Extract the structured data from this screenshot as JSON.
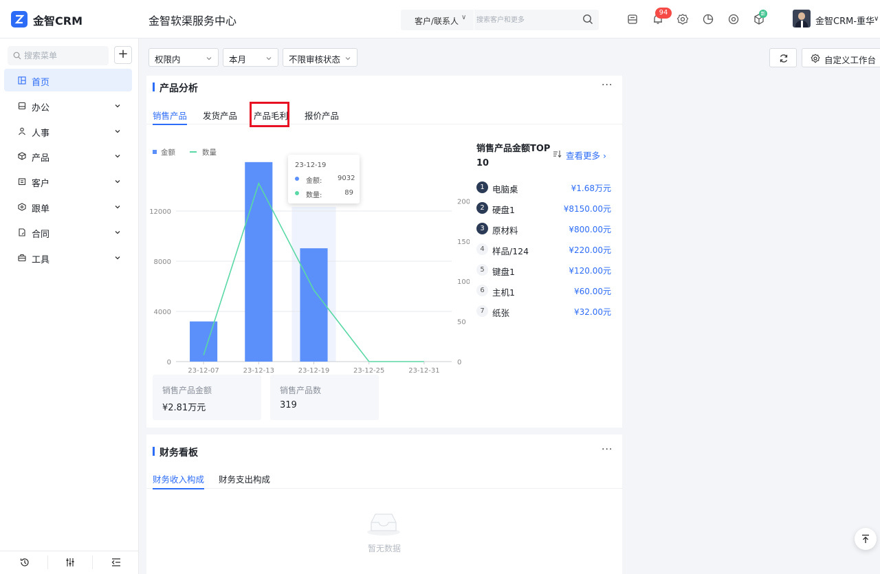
{
  "header": {
    "app_name": "金智CRM",
    "org_name": "金智软渠服务中心",
    "search_scope": "客户/联系人",
    "search_placeholder": "搜索客户和更多",
    "notification_count": "94",
    "new_badge": "新",
    "user_name": "金智CRM-重华"
  },
  "sidebar": {
    "search_placeholder": "搜索菜单",
    "items": [
      {
        "label": "首页",
        "icon": "home-icon",
        "active": true
      },
      {
        "label": "办公",
        "icon": "office-icon"
      },
      {
        "label": "人事",
        "icon": "person-icon"
      },
      {
        "label": "产品",
        "icon": "product-icon"
      },
      {
        "label": "客户",
        "icon": "customer-icon"
      },
      {
        "label": "跟单",
        "icon": "followup-icon"
      },
      {
        "label": "合同",
        "icon": "contract-icon"
      },
      {
        "label": "工具",
        "icon": "tool-icon"
      }
    ]
  },
  "filters": {
    "scope": "权限内",
    "period": "本月",
    "audit": "不限审核状态",
    "custom_label": "自定义工作台"
  },
  "product_card": {
    "title": "产品分析",
    "more": "···",
    "tabs": [
      "销售产品",
      "发货产品",
      "产品毛利",
      "报价产品"
    ],
    "legend": [
      "金额",
      "数量"
    ],
    "tooltip": {
      "date": "23-12-19",
      "amount_label": "金额:",
      "amount_value": "9032",
      "qty_label": "数量:",
      "qty_value": "89"
    },
    "stats": [
      {
        "label": "销售产品金额",
        "value": "¥2.81万元"
      },
      {
        "label": "销售产品数",
        "value": "319"
      }
    ],
    "top_title": "销售产品金额TOP 10",
    "see_more": "查看更多",
    "top_list": [
      {
        "rank": "1",
        "name": "电脑桌",
        "value": "¥1.68万元"
      },
      {
        "rank": "2",
        "name": "硬盘1",
        "value": "¥8150.00元"
      },
      {
        "rank": "3",
        "name": "原材料",
        "value": "¥800.00元"
      },
      {
        "rank": "4",
        "name": "样品/124",
        "value": "¥220.00元"
      },
      {
        "rank": "5",
        "name": "键盘1",
        "value": "¥120.00元"
      },
      {
        "rank": "6",
        "name": "主机1",
        "value": "¥60.00元"
      },
      {
        "rank": "7",
        "name": "纸张",
        "value": "¥32.00元"
      }
    ]
  },
  "chart_data": {
    "type": "bar",
    "categories": [
      "23-12-07",
      "23-12-13",
      "23-12-19",
      "23-12-25",
      "23-12-31"
    ],
    "series": [
      {
        "name": "金额",
        "type": "bar",
        "values": [
          3200,
          15900,
          9032,
          0,
          0
        ],
        "color": "#5b8ff9"
      },
      {
        "name": "数量",
        "type": "line",
        "values": [
          8,
          222,
          89,
          0,
          0
        ],
        "color": "#5ad8a6"
      }
    ],
    "y_left": {
      "ticks": [
        "0",
        "4000",
        "8000",
        "12000"
      ],
      "max": 16000
    },
    "y_right": {
      "ticks": [
        "0",
        "50",
        "100",
        "150",
        "200"
      ],
      "max": 250
    },
    "highlight_category": "23-12-19",
    "grid": true,
    "legend_position": "top-left"
  },
  "finance_card": {
    "title": "财务看板",
    "more": "···",
    "tabs": [
      "财务收入构成",
      "财务支出构成"
    ],
    "empty_text": "暂无数据"
  },
  "colors": {
    "accent": "#2d6cf6",
    "badge": "#f54a45",
    "highlight": "#e81123"
  }
}
